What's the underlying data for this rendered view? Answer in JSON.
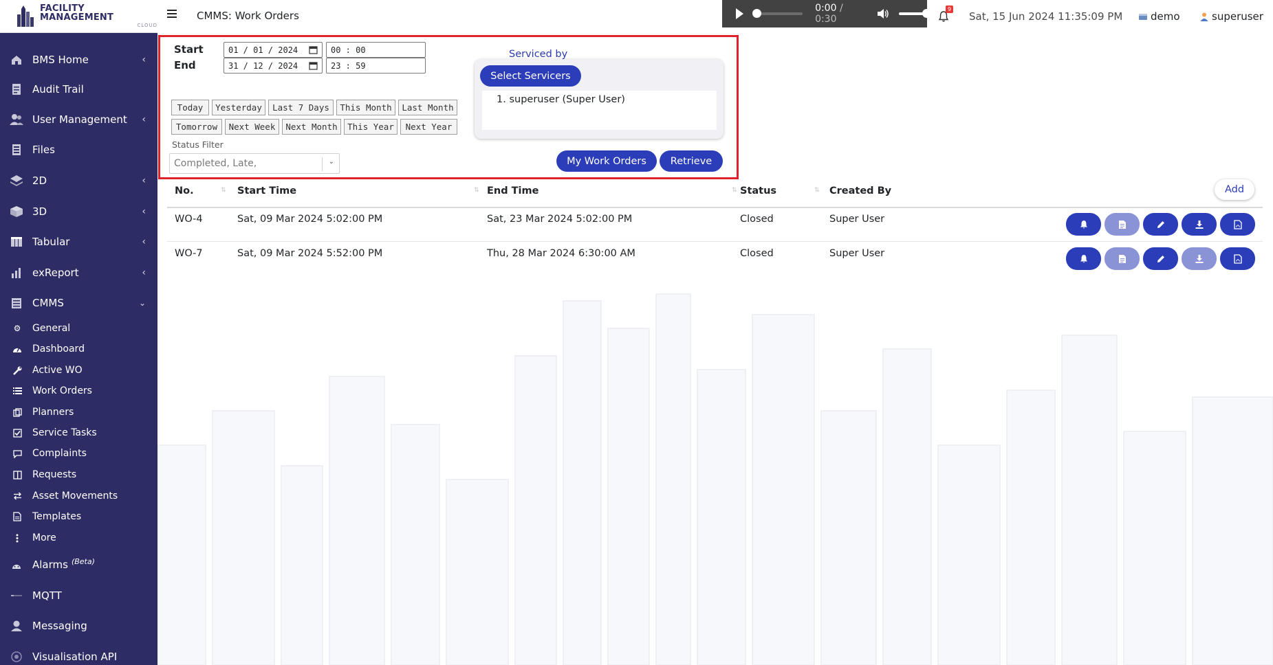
{
  "brand": {
    "title": "FACILITY MANAGEMENT",
    "subtitle": "CLOUD"
  },
  "sidebar": {
    "items": [
      {
        "label": "BMS Home",
        "icon": "home-icon"
      },
      {
        "label": "Audit Trail",
        "icon": "audit-icon"
      },
      {
        "label": "User Management",
        "icon": "users-icon"
      },
      {
        "label": "Files",
        "icon": "files-icon"
      },
      {
        "label": "2D",
        "icon": "layers-icon"
      },
      {
        "label": "3D",
        "icon": "cube-icon"
      },
      {
        "label": "Tabular",
        "icon": "table-icon"
      },
      {
        "label": "exReport",
        "icon": "report-icon"
      },
      {
        "label": "CMMS",
        "icon": "cmms-icon"
      }
    ],
    "cmms_sub": [
      {
        "label": "General",
        "icon": "cogs-icon"
      },
      {
        "label": "Dashboard",
        "icon": "dashboard-icon"
      },
      {
        "label": "Active WO",
        "icon": "wrench-icon"
      },
      {
        "label": "Work Orders",
        "icon": "list-icon"
      },
      {
        "label": "Planners",
        "icon": "clone-icon"
      },
      {
        "label": "Service Tasks",
        "icon": "check-square-icon"
      },
      {
        "label": "Complaints",
        "icon": "comment-icon"
      },
      {
        "label": "Requests",
        "icon": "columns-icon"
      },
      {
        "label": "Asset Movements",
        "icon": "exchange-icon"
      },
      {
        "label": "Templates",
        "icon": "file-icon"
      },
      {
        "label": "More",
        "icon": "ellipsis-v-icon"
      }
    ],
    "bottom": [
      {
        "label": "Alarms",
        "badge": "(Beta)",
        "icon": "alarm-icon"
      },
      {
        "label": "MQTT",
        "icon": "mqtt-icon"
      },
      {
        "label": "Messaging",
        "icon": "messaging-icon"
      },
      {
        "label": "Visualisation API",
        "icon": "api-icon"
      }
    ]
  },
  "topbar": {
    "title": "CMMS: Work Orders",
    "audio": {
      "current": "0:00",
      "separator": " / ",
      "total": "0:30",
      "progress": 0,
      "volume": 1
    },
    "notifications": "9",
    "datetime": "Sat, 15 Jun 2024 11:35:09 PM",
    "site": "demo",
    "user": "superuser"
  },
  "filter": {
    "start_label": "Start",
    "end_label": "End",
    "start_date": "01 / 01 / 2024",
    "start_time": "00 : 00",
    "end_date": "31 / 12 / 2024",
    "end_time": "23 : 59",
    "quick": [
      "Today",
      "Yesterday",
      "Last 7 Days",
      "This Month",
      "Last Month",
      "Tomorrow",
      "Next Week",
      "Next Month",
      "This Year",
      "Next Year"
    ],
    "status_label": "Status Filter",
    "status_value": "Completed, Late,",
    "serviced_title": "Serviced by",
    "select_servicers": "Select Servicers",
    "servicers": [
      "1. superuser (Super User)"
    ],
    "my_work_orders": "My Work Orders",
    "retrieve": "Retrieve"
  },
  "table": {
    "headers": [
      "No.",
      "Start Time",
      "End Time",
      "Status",
      "Created By"
    ],
    "add_label": "Add",
    "rows": [
      {
        "no": "WO-4",
        "start": "Sat, 09 Mar 2024 5:02:00 PM",
        "end": "Sat, 23 Mar 2024 5:02:00 PM",
        "status": "Closed",
        "created_by": "Super User"
      },
      {
        "no": "WO-7",
        "start": "Sat, 09 Mar 2024 5:52:00 PM",
        "end": "Thu, 28 Mar 2024 6:30:00 AM",
        "status": "Closed",
        "created_by": "Super User"
      }
    ]
  },
  "colors": {
    "sidebar": "#2e2c64",
    "accent": "#2b3db8",
    "highlight": "#e0232b"
  }
}
